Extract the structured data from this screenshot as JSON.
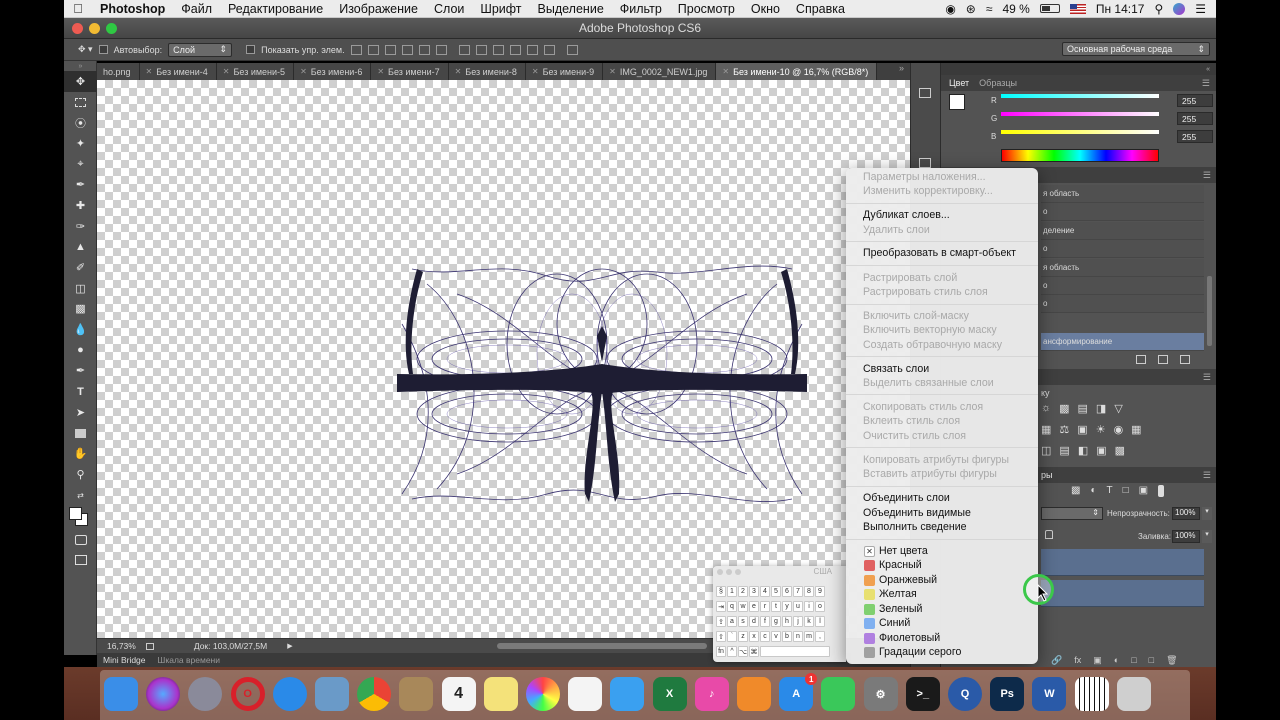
{
  "menubar": {
    "app_name": "Photoshop",
    "items": [
      "Файл",
      "Редактирование",
      "Изображение",
      "Слои",
      "Шрифт",
      "Выделение",
      "Фильтр",
      "Просмотр",
      "Окно",
      "Справка"
    ],
    "battery": "49 %",
    "clock": "Пн 14:17"
  },
  "window": {
    "title": "Adobe Photoshop CS6"
  },
  "options_bar": {
    "autoselect_label": "Автовыбор:",
    "autoselect_value": "Слой",
    "show_controls_label": "Показать упр. элем.",
    "workspace": "Основная рабочая среда"
  },
  "tabs": [
    {
      "label": "ho.png",
      "active": false
    },
    {
      "label": "Без имени-4",
      "active": false
    },
    {
      "label": "Без имени-5",
      "active": false
    },
    {
      "label": "Без имени-6",
      "active": false
    },
    {
      "label": "Без имени-7",
      "active": false
    },
    {
      "label": "Без имени-8",
      "active": false
    },
    {
      "label": "Без имени-9",
      "active": false
    },
    {
      "label": "IMG_0002_NEW1.jpg",
      "active": false
    },
    {
      "label": "Без имени-10 @ 16,7% (RGB/8*)",
      "active": true
    }
  ],
  "status": {
    "zoom": "16,73%",
    "doc": "Док: 103,0M/27,5M"
  },
  "bottom_tabs": {
    "bridge": "Mini Bridge",
    "timeline": "Шкала времени"
  },
  "color_panel": {
    "tab_color": "Цвет",
    "tab_swatches": "Образцы",
    "r_label": "R",
    "g_label": "G",
    "b_label": "B",
    "r": "255",
    "g": "255",
    "b": "255"
  },
  "history_items": [
    "я область",
    "о",
    "деление",
    "о",
    "я область",
    "о",
    "о",
    "ансформирование"
  ],
  "adjustments": {
    "title": "ку"
  },
  "layers_panel": {
    "tab_fragment": "ры",
    "opacity_label": "Непрозрачность:",
    "opacity": "100%",
    "fill_label": "Заливка:",
    "fill": "100%"
  },
  "context_menu": {
    "groups": [
      [
        {
          "label": "Параметры наложения...",
          "enabled": false
        },
        {
          "label": "Изменить корректировку...",
          "enabled": false
        }
      ],
      [
        {
          "label": "Дубликат слоев...",
          "enabled": true
        },
        {
          "label": "Удалить слои",
          "enabled": false
        }
      ],
      [
        {
          "label": "Преобразовать в смарт-объект",
          "enabled": true
        }
      ],
      [
        {
          "label": "Растрировать слой",
          "enabled": false
        },
        {
          "label": "Растрировать стиль слоя",
          "enabled": false
        }
      ],
      [
        {
          "label": "Включить слой-маску",
          "enabled": false
        },
        {
          "label": "Включить векторную маску",
          "enabled": false
        },
        {
          "label": "Создать обтравочную маску",
          "enabled": false
        }
      ],
      [
        {
          "label": "Связать слои",
          "enabled": true
        },
        {
          "label": "Выделить связанные слои",
          "enabled": false
        }
      ],
      [
        {
          "label": "Скопировать стиль слоя",
          "enabled": false
        },
        {
          "label": "Вклеить стиль слоя",
          "enabled": false
        },
        {
          "label": "Очистить стиль слоя",
          "enabled": false
        }
      ],
      [
        {
          "label": "Копировать атрибуты фигуры",
          "enabled": false
        },
        {
          "label": "Вставить атрибуты фигуры",
          "enabled": false
        }
      ],
      [
        {
          "label": "Объединить слои",
          "enabled": true
        },
        {
          "label": "Объединить видимые",
          "enabled": true
        },
        {
          "label": "Выполнить сведение",
          "enabled": true
        }
      ]
    ],
    "colors": [
      {
        "label": "Нет цвета",
        "color": "none"
      },
      {
        "label": "Красный",
        "color": "#e06060"
      },
      {
        "label": "Оранжевый",
        "color": "#f0a050"
      },
      {
        "label": "Желтая",
        "color": "#e8e070"
      },
      {
        "label": "Зеленый",
        "color": "#80d070"
      },
      {
        "label": "Синий",
        "color": "#80b0f0"
      },
      {
        "label": "Фиолетовый",
        "color": "#b080e0"
      },
      {
        "label": "Градации серого",
        "color": "#a0a0a0"
      }
    ]
  },
  "keyboard_viewer": {
    "title": "США",
    "rows": [
      [
        "§",
        "1",
        "2",
        "3",
        "4",
        "5",
        "6",
        "7",
        "8",
        "9"
      ],
      [
        "⇥",
        "q",
        "w",
        "e",
        "r",
        "t",
        "y",
        "u",
        "i",
        "o"
      ],
      [
        "⇪",
        "a",
        "s",
        "d",
        "f",
        "g",
        "h",
        "j",
        "k",
        "l"
      ],
      [
        "⇧",
        "`",
        "z",
        "x",
        "c",
        "v",
        "b",
        "n",
        "m",
        ","
      ],
      [
        "fn",
        "^",
        "⌥",
        "⌘"
      ]
    ]
  },
  "dock": {
    "apps": [
      {
        "name": "finder-icon",
        "label": "",
        "color": "#3a8ee8"
      },
      {
        "name": "siri-icon",
        "label": "",
        "color": "#5a3aa8"
      },
      {
        "name": "launchpad-icon",
        "label": "",
        "color": "#8a8a9a"
      },
      {
        "name": "opera-icon",
        "label": "O",
        "color": "#d8202a"
      },
      {
        "name": "safari-icon",
        "label": "",
        "color": "#2a8ae8"
      },
      {
        "name": "preview-icon",
        "label": "",
        "color": "#6a9ac8"
      },
      {
        "name": "chrome-icon",
        "label": "",
        "color": "#e8e8e8"
      },
      {
        "name": "contacts-icon",
        "label": "",
        "color": "#a8885a"
      },
      {
        "name": "calendar-icon",
        "label": "4",
        "color": "#f4f4f4"
      },
      {
        "name": "notes-icon",
        "label": "",
        "color": "#f4e27a"
      },
      {
        "name": "photos-icon",
        "label": "",
        "color": "#f0a040"
      },
      {
        "name": "reminders-icon",
        "label": "",
        "color": "#f4f4f4"
      },
      {
        "name": "messages-icon",
        "label": "",
        "color": "#3aa0f0"
      },
      {
        "name": "excel-icon",
        "label": "X",
        "color": "#1f7a3f"
      },
      {
        "name": "itunes-icon",
        "label": "♪",
        "color": "#e84aa8"
      },
      {
        "name": "ibooks-icon",
        "label": "",
        "color": "#f08a2a"
      },
      {
        "name": "appstore-icon",
        "label": "A",
        "color": "#2a8ae8"
      },
      {
        "name": "facetime-icon",
        "label": "",
        "color": "#3ac85a"
      },
      {
        "name": "system-preferences-icon",
        "label": "⚙",
        "color": "#7a7a7a"
      },
      {
        "name": "terminal-icon",
        "label": ">_",
        "color": "#1a1a1a"
      },
      {
        "name": "quicktime-icon",
        "label": "Q",
        "color": "#2a5aa8"
      },
      {
        "name": "photoshop-icon",
        "label": "Ps",
        "color": "#0d2a4a"
      },
      {
        "name": "word-icon",
        "label": "W",
        "color": "#2a5aa8"
      },
      {
        "name": "piano-icon",
        "label": "",
        "color": "#1a1a1a"
      },
      {
        "name": "trash-icon",
        "label": "",
        "color": "#cfcfcf"
      }
    ],
    "badge": "1"
  }
}
